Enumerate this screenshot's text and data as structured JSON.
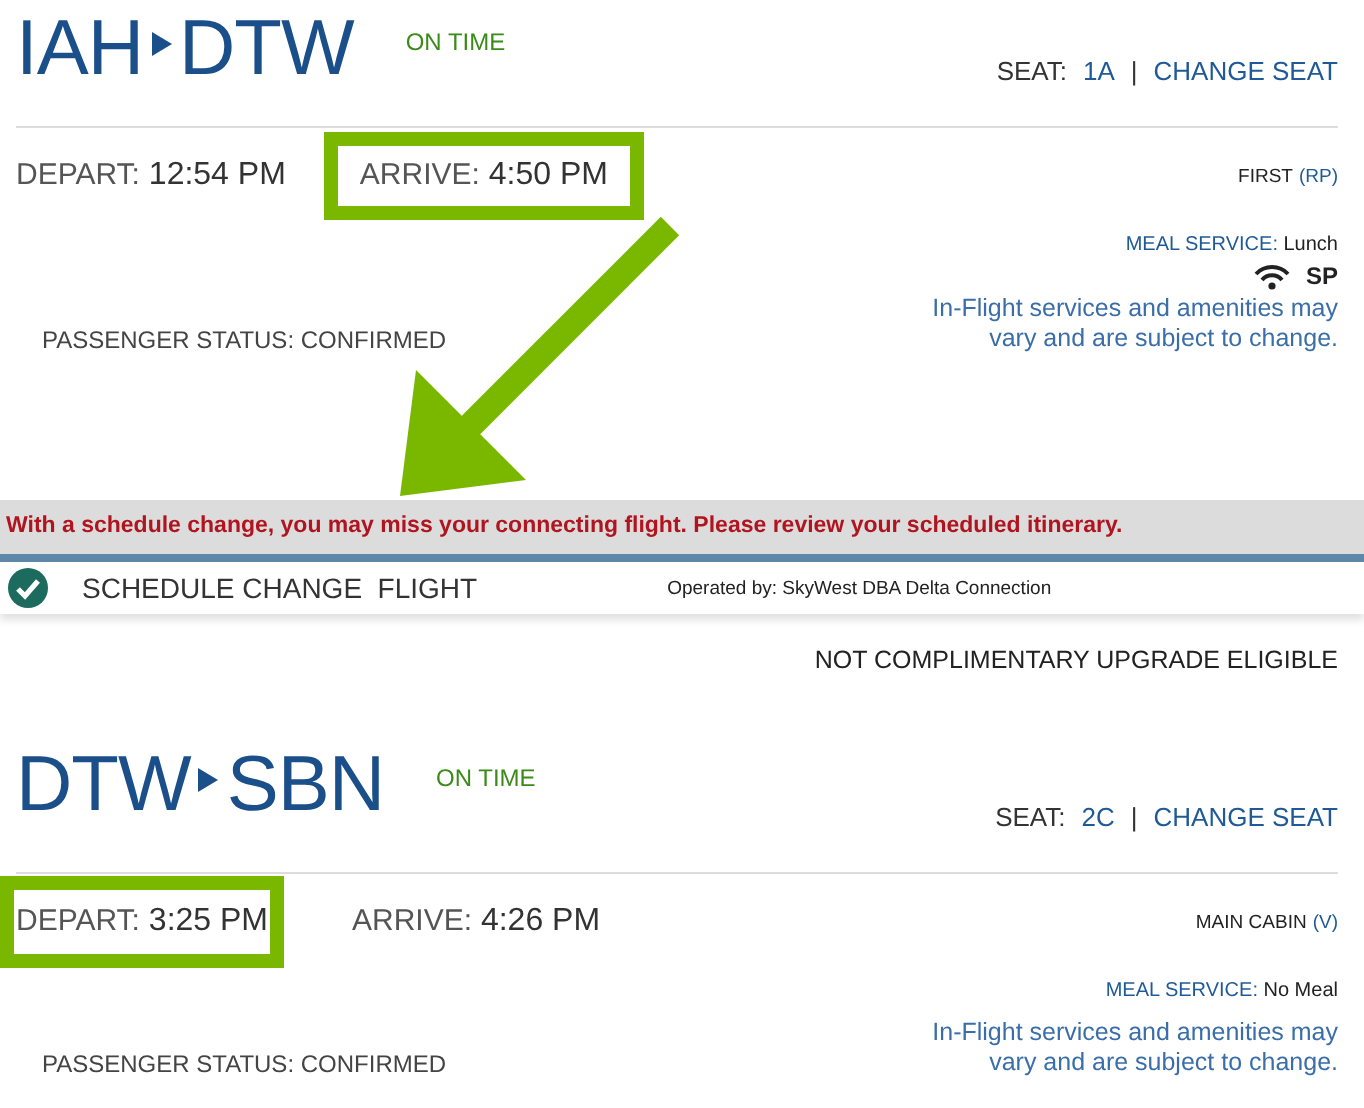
{
  "flights": [
    {
      "origin": "IAH",
      "destination": "DTW",
      "status": "ON TIME",
      "seat_label": "SEAT:",
      "seat": "1A",
      "separator": "|",
      "change_seat": "CHANGE SEAT",
      "depart_label": "DEPART:",
      "depart_time": "12:54 PM",
      "depart_highlighted": false,
      "arrive_label": "ARRIVE:",
      "arrive_time": "4:50 PM",
      "arrive_highlighted": true,
      "cabin": "FIRST",
      "fare_class": "(RP)",
      "meal_label": "MEAL SERVICE:",
      "meal": "Lunch",
      "wifi": true,
      "entertainment": "SP",
      "services_note": "In-Flight services and amenities may vary and are subject to change.",
      "passenger_status": "PASSENGER STATUS: CONFIRMED"
    },
    {
      "origin": "DTW",
      "destination": "SBN",
      "status": "ON TIME",
      "seat_label": "SEAT:",
      "seat": "2C",
      "separator": "|",
      "change_seat": "CHANGE SEAT",
      "depart_label": "DEPART:",
      "depart_time": "3:25 PM",
      "depart_highlighted": true,
      "arrive_label": "ARRIVE:",
      "arrive_time": "4:26 PM",
      "arrive_highlighted": false,
      "cabin": "MAIN CABIN",
      "fare_class": "(V)",
      "meal_label": "MEAL SERVICE:",
      "meal": "No Meal",
      "services_note": "In-Flight services and amenities may vary and are subject to change.",
      "passenger_status": "PASSENGER STATUS: CONFIRMED"
    }
  ],
  "alert": "With a schedule change, you may miss your connecting flight. Please review your scheduled itinerary.",
  "schedule_change": {
    "checked": true,
    "title": "SCHEDULE CHANGE  FLIGHT",
    "operated_by": "Operated by: SkyWest DBA Delta Connection"
  },
  "upgrade_note": "NOT COMPLIMENTARY UPGRADE ELIGIBLE"
}
